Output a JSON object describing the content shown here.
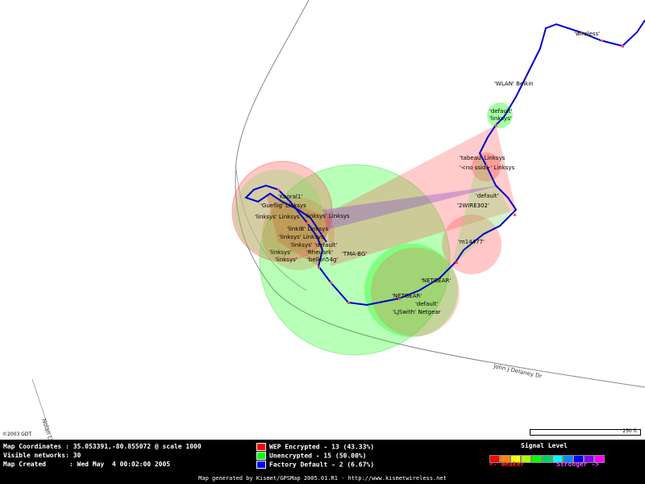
{
  "map": {
    "copyright": "©2003 GDT",
    "scale_label": "250 ft",
    "roads": [
      {
        "name": "John J Delaney Dr"
      },
      {
        "name": "Nolan Ln"
      }
    ],
    "network_labels": [
      "'wireless'",
      "'WLAN' Belkin",
      "'default'",
      "'linksys'",
      "'tabeau' Linksys",
      "'<no ssid>' Linksys",
      "'default'",
      "'2WIRE302'",
      "'Kooral1'",
      "'Gueflig' Linksys",
      "'linksys' Linksys",
      "'linksys' Linksys",
      "'linkIB' Linksys",
      "'linksys' Linksys",
      "'linksys'",
      "'linksys'",
      "'default'",
      "'Rheuark'",
      "'belkin54g'",
      "'TMA-BG'",
      "'linksys'",
      "'m14477'",
      "'NETGEAR'",
      "'NETGEAR'",
      "'default'",
      "'LJSwith' Netgear"
    ]
  },
  "info": {
    "coords_label": "Map Coordinates",
    "coords_value": "35.053391,-80.855072 @ scale 1000",
    "visible_label": "Visible networks",
    "visible_value": "30",
    "created_label": "Map Created",
    "created_value": "Wed May  4 00:02:00 2005"
  },
  "legend": {
    "items": [
      {
        "label": "WEP Encrypted - 13 (43.33%)",
        "color": "#ff0000"
      },
      {
        "label": "Unencrypted - 15 (50.00%)",
        "color": "#00ff00"
      },
      {
        "label": "Factory Default - 2 (6.67%)",
        "color": "#0000ff"
      }
    ]
  },
  "signal": {
    "title": "Signal Level",
    "weaker": "<- Weaker",
    "stronger": "Stronger ->",
    "colors": [
      "#ff0000",
      "#ff8800",
      "#ffff00",
      "#aaff00",
      "#00ff00",
      "#00cc66",
      "#00ffff",
      "#0088ff",
      "#0000ff",
      "#8800ff",
      "#ff00ff",
      "#ff0088"
    ]
  },
  "footer": {
    "generated": "Map generated by Kismet/GPSMap 2005.01.R1 - http://www.kismetwireless.net"
  },
  "colors": {
    "wep": "#ff0000",
    "open": "#00ff00",
    "default": "#0000ff",
    "track": "#0000cc"
  }
}
